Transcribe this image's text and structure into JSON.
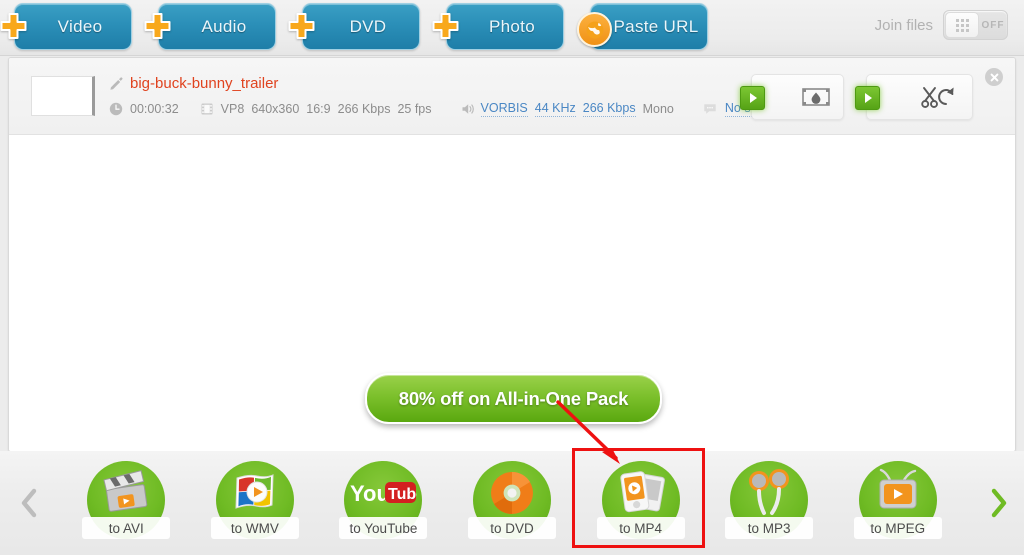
{
  "toolbar": {
    "buttons": [
      {
        "label": "Video",
        "icon": "plus-icon"
      },
      {
        "label": "Audio",
        "icon": "plus-icon"
      },
      {
        "label": "DVD",
        "icon": "plus-icon"
      },
      {
        "label": "Photo",
        "icon": "plus-icon"
      },
      {
        "label": "Paste URL",
        "icon": "globe-icon"
      }
    ],
    "join_files_label": "Join files",
    "join_files_state": "OFF"
  },
  "file": {
    "name": "big-buck-bunny_trailer",
    "duration": "00:00:32",
    "video_codec": "VP8",
    "resolution": "640x360",
    "aspect": "16:9",
    "video_bitrate": "266 Kbps",
    "fps": "25 fps",
    "audio_codec": "VORBIS",
    "audio_rate": "44 KHz",
    "audio_bitrate": "266 Kbps",
    "audio_channels": "Mono",
    "subtitles": "No subtitles",
    "effects_button": "effects",
    "trim_button": "trim-rotate",
    "close_button": "remove-file"
  },
  "promo": {
    "label": "80% off on All-in-One Pack"
  },
  "formats": {
    "prev_label": "previous-formats",
    "next_label": "next-formats",
    "items": [
      {
        "label": "to AVI",
        "icon": "clapperboard-icon",
        "selected": false
      },
      {
        "label": "to WMV",
        "icon": "windows-media-icon",
        "selected": false
      },
      {
        "label": "to YouTube",
        "icon": "youtube-icon",
        "selected": false
      },
      {
        "label": "to DVD",
        "icon": "disc-icon",
        "selected": false
      },
      {
        "label": "to MP4",
        "icon": "mp4-player-icon",
        "selected": true
      },
      {
        "label": "to MP3",
        "icon": "earbuds-icon",
        "selected": false
      },
      {
        "label": "to MPEG",
        "icon": "tv-icon",
        "selected": false
      }
    ]
  },
  "colors": {
    "accent_blue": "#2b8fb8",
    "accent_orange": "#f5a11a",
    "accent_green": "#6fbb24",
    "promo_green": "#7cc02c",
    "highlight_red": "#ee1111",
    "filename_red": "#e0431f",
    "link_blue": "#4a87c4"
  }
}
